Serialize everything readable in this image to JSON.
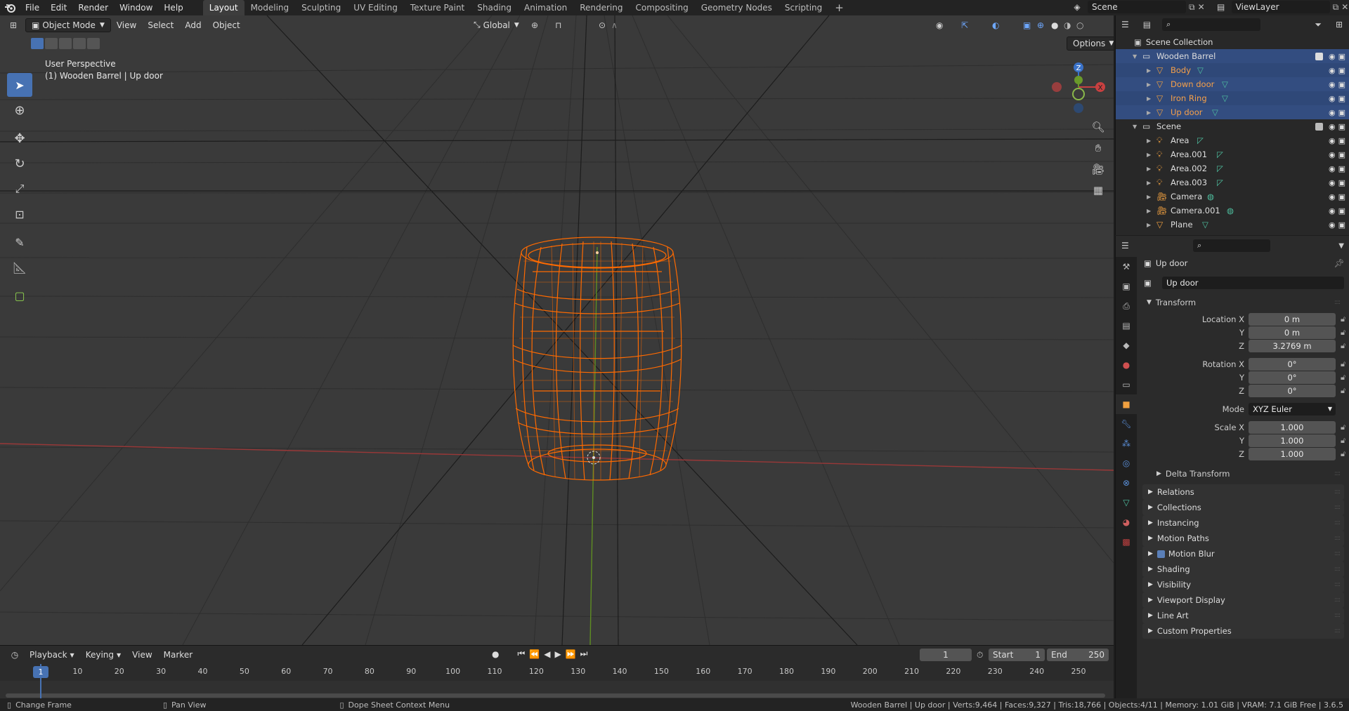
{
  "topbar": {
    "menus": [
      "File",
      "Edit",
      "Render",
      "Window",
      "Help"
    ],
    "workspaces": [
      "Layout",
      "Modeling",
      "Sculpting",
      "UV Editing",
      "Texture Paint",
      "Shading",
      "Animation",
      "Rendering",
      "Compositing",
      "Geometry Nodes",
      "Scripting"
    ],
    "active_workspace": "Layout",
    "scene_name": "Scene",
    "view_layer": "ViewLayer"
  },
  "viewport": {
    "mode": "Object Mode",
    "menus": [
      "View",
      "Select",
      "Add",
      "Object"
    ],
    "orientation": "Global",
    "options_label": "Options",
    "perspective_label": "User Perspective",
    "object_label": "(1) Wooden Barrel | Up door",
    "gizmo": {
      "x": "X",
      "z": "Z"
    },
    "colors": {
      "background": "#3a3a3a",
      "selection": "#ff6a00",
      "x_axis": "#b04040",
      "y_axis": "#6a9a2a"
    }
  },
  "timeline": {
    "menus": [
      "Playback",
      "Keying",
      "View",
      "Marker"
    ],
    "current_frame": "1",
    "start_label": "Start",
    "start": "1",
    "end_label": "End",
    "end": "250",
    "ticks": [
      "1",
      "10",
      "20",
      "30",
      "40",
      "50",
      "60",
      "70",
      "80",
      "90",
      "100",
      "110",
      "120",
      "130",
      "140",
      "150",
      "160",
      "170",
      "180",
      "190",
      "200",
      "210",
      "220",
      "230",
      "240",
      "250"
    ]
  },
  "statusbar": {
    "left": "Change Frame",
    "middle": "Pan View",
    "right": "Dope Sheet Context Menu",
    "info": "Wooden Barrel | Up door | Verts:9,464 | Faces:9,327 | Tris:18,766 | Objects:4/11 | Memory: 1.01 GiB | VRAM: 7.1 GiB Free | 3.6.5"
  },
  "outliner": {
    "root": "Scene Collection",
    "items": [
      {
        "name": "Wooden Barrel",
        "level": 1,
        "kind": "collection",
        "selected": true,
        "highlight": false
      },
      {
        "name": "Body",
        "level": 2,
        "kind": "mesh",
        "selected": true,
        "highlight": true
      },
      {
        "name": "Down door",
        "level": 2,
        "kind": "mesh",
        "selected": true,
        "highlight": true
      },
      {
        "name": "Iron Ring",
        "level": 2,
        "kind": "mesh",
        "selected": true,
        "highlight": true
      },
      {
        "name": "Up door",
        "level": 2,
        "kind": "mesh",
        "selected": true,
        "highlight": true
      },
      {
        "name": "Scene",
        "level": 1,
        "kind": "collection",
        "selected": false,
        "highlight": false
      },
      {
        "name": "Area",
        "level": 2,
        "kind": "light",
        "selected": false,
        "highlight": false
      },
      {
        "name": "Area.001",
        "level": 2,
        "kind": "light",
        "selected": false,
        "highlight": false
      },
      {
        "name": "Area.002",
        "level": 2,
        "kind": "light",
        "selected": false,
        "highlight": false
      },
      {
        "name": "Area.003",
        "level": 2,
        "kind": "light",
        "selected": false,
        "highlight": false
      },
      {
        "name": "Camera",
        "level": 2,
        "kind": "camera",
        "selected": false,
        "highlight": false
      },
      {
        "name": "Camera.001",
        "level": 2,
        "kind": "camera",
        "selected": false,
        "highlight": false
      },
      {
        "name": "Plane",
        "level": 2,
        "kind": "mesh",
        "selected": false,
        "highlight": false
      }
    ]
  },
  "properties": {
    "object_name": "Up door",
    "name_field": "Up door",
    "transform_label": "Transform",
    "location": {
      "label_x": "Location X",
      "x": "0 m",
      "y": "0 m",
      "z": "3.2769 m"
    },
    "rotation": {
      "label_x": "Rotation X",
      "x": "0°",
      "y": "0°",
      "z": "0°"
    },
    "axis_y": "Y",
    "axis_z": "Z",
    "mode_label": "Mode",
    "mode_value": "XYZ Euler",
    "scale": {
      "label_x": "Scale X",
      "x": "1.000",
      "y": "1.000",
      "z": "1.000"
    },
    "delta_transform": "Delta Transform",
    "panels": [
      "Relations",
      "Collections",
      "Instancing",
      "Motion Paths",
      "Motion Blur",
      "Shading",
      "Visibility",
      "Viewport Display",
      "Line Art",
      "Custom Properties"
    ]
  }
}
